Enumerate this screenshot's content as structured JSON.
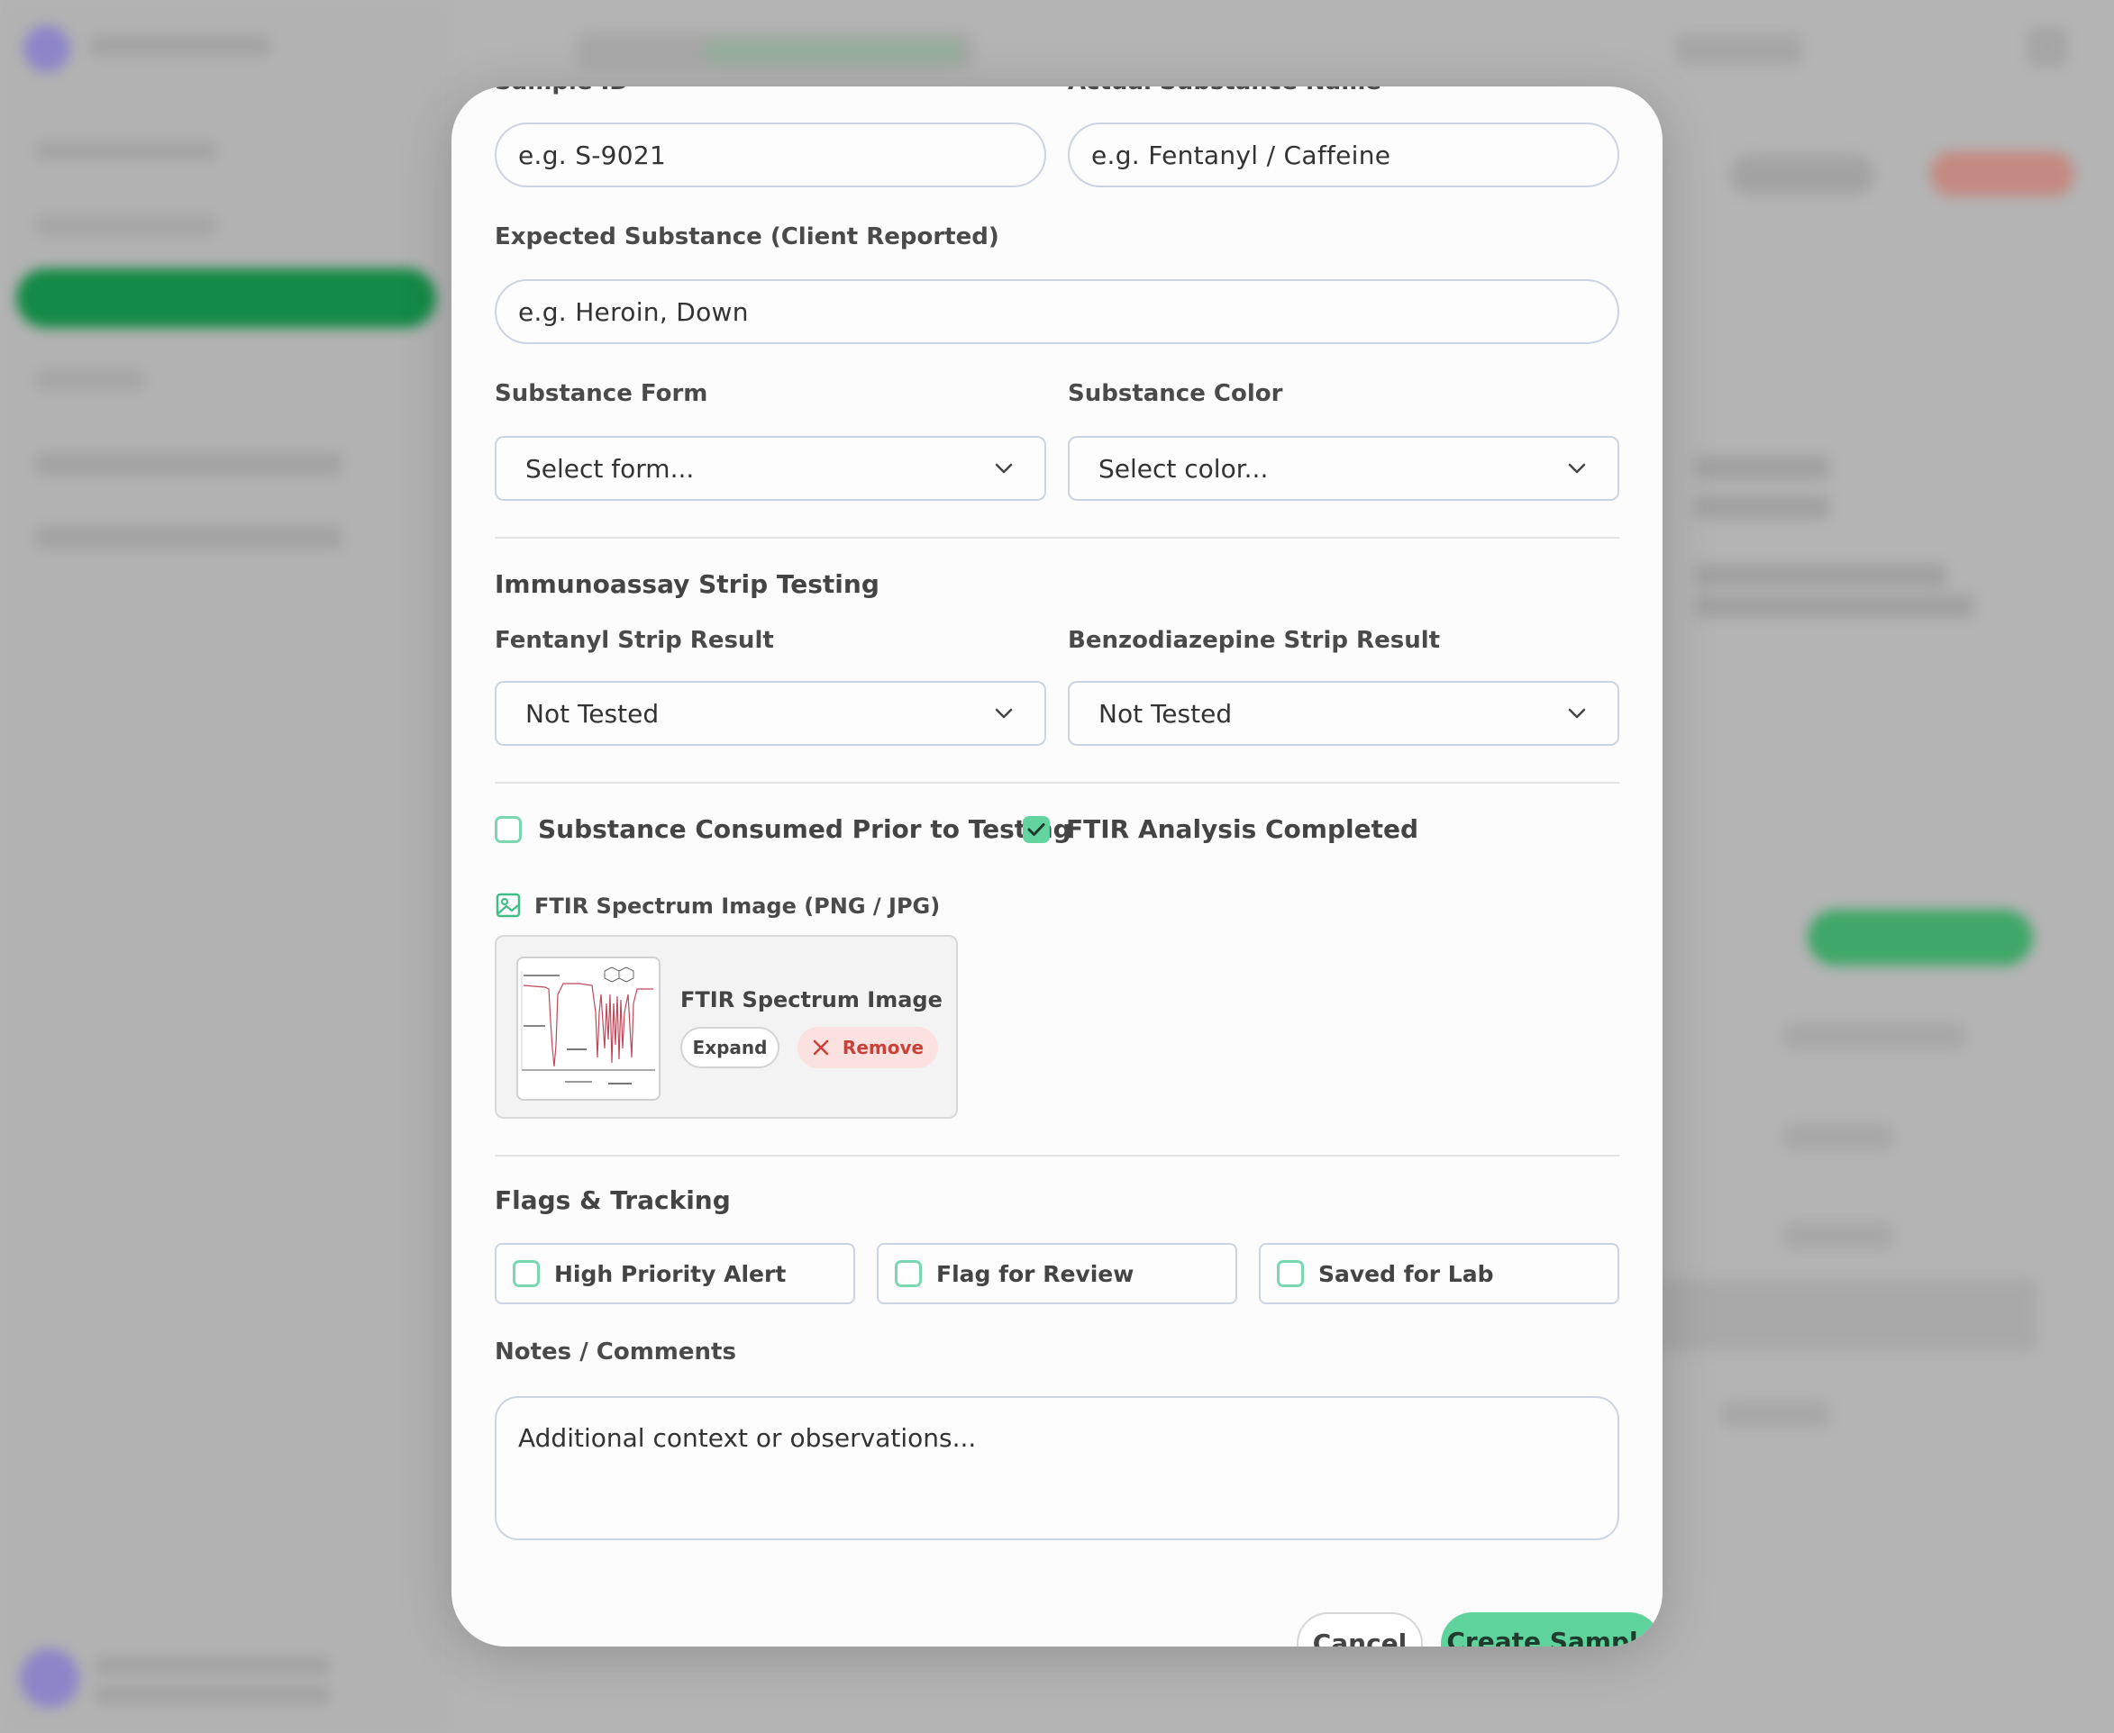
{
  "form": {
    "sample_id": {
      "label": "Sample ID",
      "placeholder": "e.g. S-9021"
    },
    "actual_substance": {
      "label": "Actual Substance Name",
      "placeholder": "e.g. Fentanyl / Caffeine"
    },
    "expected_substance": {
      "label": "Expected Substance (Client Reported)",
      "placeholder": "e.g. Heroin, Down"
    },
    "substance_form": {
      "label": "Substance Form",
      "value": "Select form..."
    },
    "substance_color": {
      "label": "Substance Color",
      "value": "Select color..."
    },
    "strip_section_title": "Immunoassay Strip Testing",
    "fentanyl_strip": {
      "label": "Fentanyl Strip Result",
      "value": "Not Tested"
    },
    "benzo_strip": {
      "label": "Benzodiazepine Strip Result",
      "value": "Not Tested"
    },
    "consumed_prior": {
      "label": "Substance Consumed Prior to Testing",
      "checked": false
    },
    "ftir_completed": {
      "label": "FTIR Analysis Completed",
      "checked": true
    },
    "ftir_image": {
      "label": "FTIR Spectrum Image (PNG / JPG)",
      "file_name": "FTIR Spectrum Image",
      "expand_label": "Expand",
      "remove_label": "Remove"
    },
    "flags_title": "Flags & Tracking",
    "flags": [
      {
        "label": "High Priority Alert",
        "checked": false
      },
      {
        "label": "Flag for Review",
        "checked": false
      },
      {
        "label": "Saved for Lab",
        "checked": false
      }
    ],
    "notes": {
      "label": "Notes / Comments",
      "placeholder": "Additional context or observations..."
    }
  },
  "actions": {
    "cancel_label": "Cancel",
    "create_label": "Create Sample"
  },
  "colors": {
    "accent_green": "#5fd39c",
    "remove_red": "#c8423a",
    "border": "#ccd3e3"
  },
  "icons": [
    "image-icon",
    "close-icon",
    "chevron-down-icon",
    "check-icon"
  ]
}
